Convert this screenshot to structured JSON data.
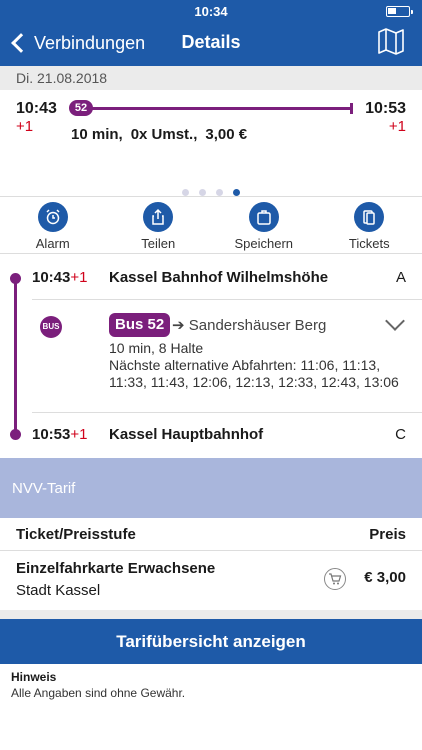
{
  "status": {
    "time": "10:34"
  },
  "nav": {
    "back_label": "Verbindungen",
    "title": "Details",
    "map_icon": "map-icon"
  },
  "date": "Di. 21.08.2018",
  "summary": {
    "dep_time": "10:43",
    "dep_delay": "+1",
    "arr_time": "10:53",
    "arr_delay": "+1",
    "line": "52",
    "duration": "10 min,",
    "transfers": "0x Umst.,",
    "price": "3,00 €"
  },
  "pager": {
    "count": 4,
    "active": 3
  },
  "actions": [
    {
      "label": "Alarm",
      "icon": "alarm-clock-icon"
    },
    {
      "label": "Teilen",
      "icon": "share-icon"
    },
    {
      "label": "Speichern",
      "icon": "briefcase-icon"
    },
    {
      "label": "Tickets",
      "icon": "ticket-icon"
    }
  ],
  "journey": {
    "start": {
      "time": "10:43",
      "delay": "+1",
      "name": "Kassel Bahnhof Wilhelmshöhe",
      "platform": "A"
    },
    "leg": {
      "mode": "BUS",
      "line": "Bus 52",
      "direction": "Sandershäuser Berg",
      "stats": "10 min, 8 Halte",
      "alternatives": "Nächste alternative Abfahrten: 11:06, 11:13, 11:33, 11:43, 12:06, 12:13, 12:33, 12:43, 13:06"
    },
    "end": {
      "time": "10:53",
      "delay": "+1",
      "name": "Kassel Hauptbahnhof",
      "platform": "C"
    }
  },
  "tariff": {
    "name": "NVV-Tarif",
    "col_ticket": "Ticket/Preisstufe",
    "col_price": "Preis",
    "ticket_name": "Einzelfahrkarte Erwachsene",
    "zone": "Stadt Kassel",
    "price": "€ 3,00"
  },
  "cta_label": "Tarifübersicht anzeigen",
  "hint": {
    "title": "Hinweis",
    "text": "Alle Angaben sind ohne Gewähr."
  },
  "colors": {
    "primary": "#1e5aa8",
    "bus": "#7b1f7c",
    "delay": "#d0021b",
    "tariff_band": "#a9b6dc"
  }
}
